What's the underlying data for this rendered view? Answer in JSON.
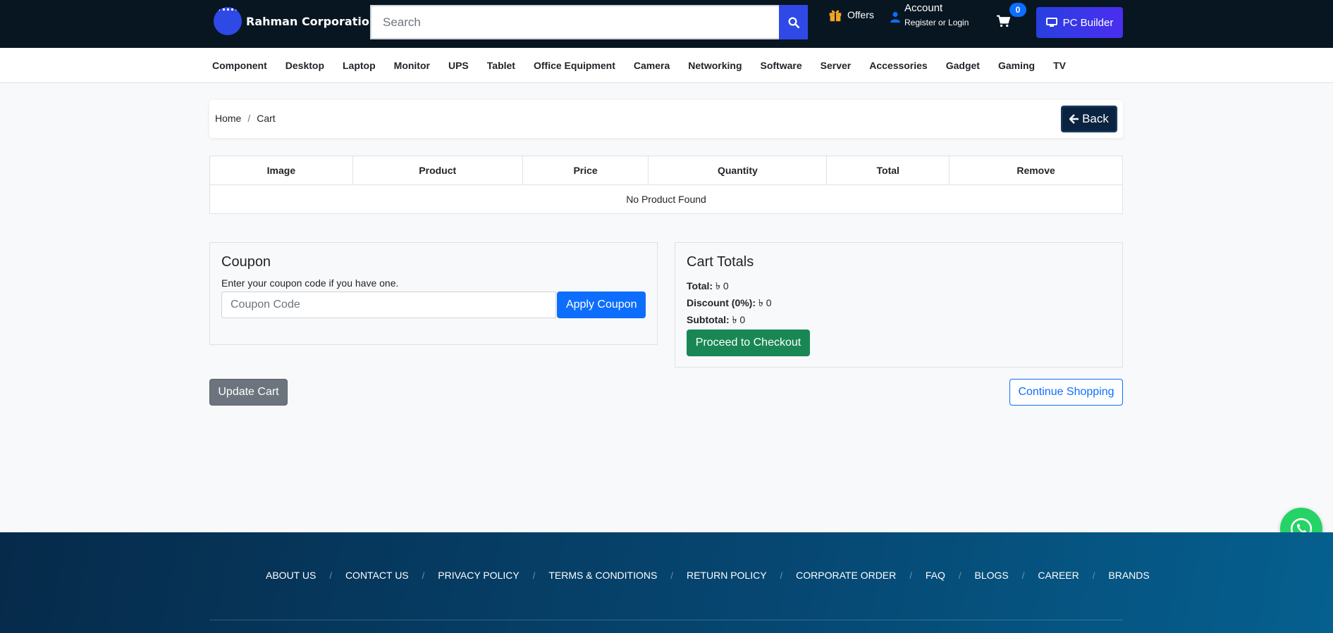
{
  "brand": {
    "name": "Rahman Corporation"
  },
  "search": {
    "placeholder": "Search"
  },
  "header": {
    "offers_label": "Offers",
    "account_title": "Account",
    "account_sub": "Register or Login",
    "cart_count": "0",
    "pc_builder_label": "PC Builder"
  },
  "categories": [
    "Component",
    "Desktop",
    "Laptop",
    "Monitor",
    "UPS",
    "Tablet",
    "Office Equipment",
    "Camera",
    "Networking",
    "Software",
    "Server",
    "Accessories",
    "Gadget",
    "Gaming",
    "TV"
  ],
  "breadcrumb": {
    "home": "Home",
    "separator": "/",
    "current": "Cart",
    "back_label": "Back"
  },
  "cart_table": {
    "columns": [
      "Image",
      "Product",
      "Price",
      "Quantity",
      "Total",
      "Remove"
    ],
    "empty_message": "No Product Found"
  },
  "coupon": {
    "title": "Coupon",
    "hint": "Enter your coupon code if you have one.",
    "placeholder": "Coupon Code",
    "apply_label": "Apply Coupon"
  },
  "totals": {
    "title": "Cart Totals",
    "total_label": "Total:",
    "total_value": "৳ 0",
    "discount_label": "Discount (0%):",
    "discount_value": "৳ 0",
    "subtotal_label": "Subtotal:",
    "subtotal_value": "৳ 0",
    "checkout_label": "Proceed to Checkout"
  },
  "actions": {
    "update_label": "Update Cart",
    "continue_label": "Continue Shopping"
  },
  "footer": {
    "links": [
      "ABOUT US",
      "CONTACT US",
      "PRIVACY POLICY",
      "TERMS & CONDITIONS",
      "RETURN POLICY",
      "CORPORATE ORDER",
      "FAQ",
      "BLOGS",
      "CAREER",
      "BRANDS"
    ],
    "separator": "/"
  },
  "icons": {
    "search": "search-icon",
    "offers": "gift-icon",
    "account": "user-icon",
    "cart": "cart-icon",
    "pc_builder": "desktop-icon",
    "back": "arrow-left-icon",
    "whatsapp": "whatsapp-icon"
  },
  "colors": {
    "topbar": "#081621",
    "accent_blue": "#2f49e6",
    "primary": "#0d6efd",
    "success": "#198754",
    "secondary": "#6c757d",
    "back_button": "#0a2341",
    "offers_icon": "#f5a623",
    "whatsapp": "#25d366"
  }
}
